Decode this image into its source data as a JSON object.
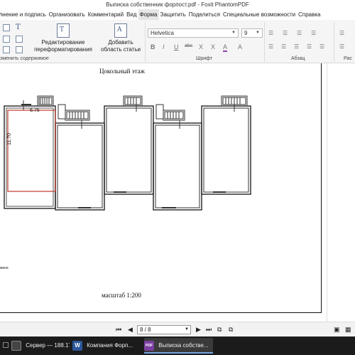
{
  "window": {
    "title": "Выписка собственник форпост.pdf - Foxit PhantomPDF"
  },
  "menu": {
    "items": [
      "полнение и подпись",
      "Организовать",
      "Комментарий",
      "Вид",
      "Форма",
      "Защитить",
      "Поделиться",
      "Специальные возможности",
      "Справка"
    ]
  },
  "ribbon": {
    "edit_group_label": "зменить содержимое",
    "reformat_label_1": "Редактирование",
    "reformat_label_2": "переформатирования",
    "add_article_label_1": "Добавить",
    "add_article_label_2": "область статьи",
    "font_group_label": "Шрифт",
    "paragraph_group_label": "Абзац",
    "layout_group_label": "Рас",
    "font_name": "Helvetica",
    "font_size": "9",
    "format_buttons": [
      "B",
      "I",
      "U",
      "abc",
      "X",
      "X",
      "A",
      "A"
    ]
  },
  "document": {
    "page_title": "Цокольный этаж",
    "room_width": "6.75",
    "room_height": "11.70",
    "scale": "масштаб 1:200",
    "side_snippet": "мене"
  },
  "navigation": {
    "page_display": "8 / 8"
  },
  "taskbar": {
    "tasks": [
      {
        "label": "Сервер — 188.17....",
        "icon": "server-icon"
      },
      {
        "label": "Компания Форп...",
        "icon": "word-icon",
        "icon_letter": "W"
      },
      {
        "label": "Выписка собстве...",
        "icon": "foxit-icon",
        "icon_letter": "PDF"
      }
    ]
  },
  "colors": {
    "accent": "#76a6e0",
    "room_highlight": "#c0392b",
    "foxit_icon": "#7b3fa0",
    "word_icon": "#2b579a"
  }
}
